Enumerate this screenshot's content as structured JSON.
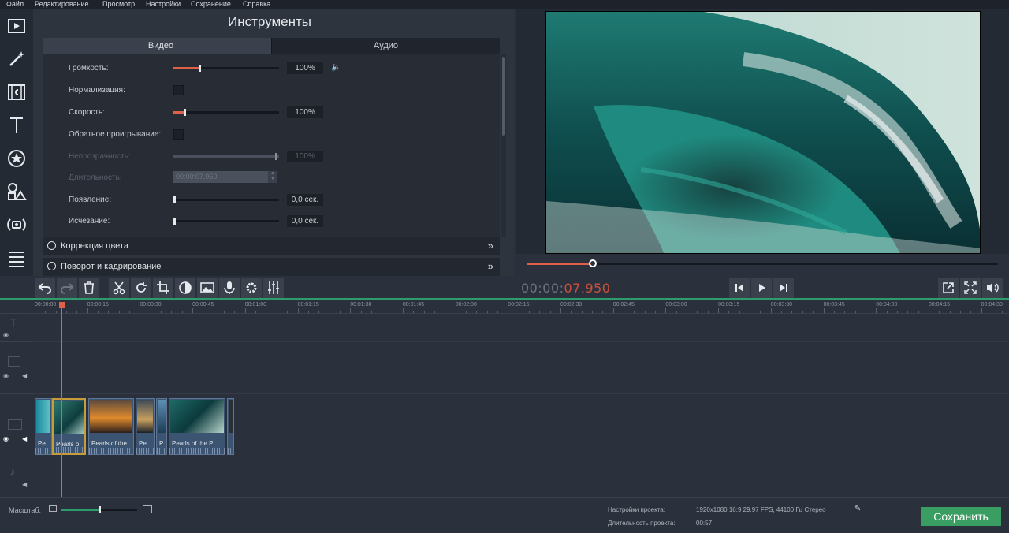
{
  "menu": [
    "Файл",
    "Редактирование",
    "Просмотр",
    "Настройки",
    "Сохранение",
    "Справка"
  ],
  "tools_panel": {
    "title": "Инструменты",
    "tabs": [
      "Видео",
      "Аудио"
    ],
    "properties": {
      "volume_label": "Громкость:",
      "volume_value": "100%",
      "volume_level": 0.25,
      "normalization_label": "Нормализация:",
      "speed_label": "Скорость:",
      "speed_value": "100%",
      "speed_level": 0.1,
      "reverse_label": "Обратное проигрывание:",
      "opacity_label": "Непрозрачность:",
      "opacity_value": "100%",
      "duration_label": "Длительность:",
      "duration_value": "00:00:07.950",
      "fadein_label": "Появление:",
      "fadein_value": "0,0 сек.",
      "fadeout_label": "Исчезание:",
      "fadeout_value": "0,0 сек."
    },
    "sections": [
      "Коррекция цвета",
      "Поворот и кадрирование"
    ]
  },
  "player": {
    "timecode_elapsed": "00:00:",
    "timecode_current": "07.950",
    "progress": 0.14
  },
  "timeline": {
    "ticks": [
      "00:00:00",
      "00:00:15",
      "00:00:30",
      "00:00:45",
      "00:01:00",
      "00:01:15",
      "00:01:30",
      "00:01:45",
      "00:02:00",
      "00:02:15",
      "00:02:30",
      "00:02:45",
      "00:03:00",
      "00:03:15",
      "00:03:30",
      "00:03:45",
      "00:04:00",
      "00:04:15",
      "00:04:30"
    ],
    "clips": [
      {
        "title": "Pe"
      },
      {
        "title": "Pearls o"
      },
      {
        "title": "Pearls of the"
      },
      {
        "title": "Pe"
      },
      {
        "title": "P"
      },
      {
        "title": "Pearls of the P"
      },
      {
        "title": ""
      }
    ]
  },
  "status": {
    "scale_label": "Масштаб:",
    "scale_level": 0.5,
    "project_settings_label": "Настройки проекта:",
    "project_settings_value": "1920x1080 16:9 29.97 FPS, 44100 Гц Стерео",
    "project_duration_label": "Длительность проекта:",
    "project_duration_value": "00:57",
    "save_label": "Сохранить"
  },
  "colors": {
    "accent": "#e0604a",
    "save": "#3a9e63",
    "timeline_line": "#2e9c6a"
  },
  "icons": [
    "import-icon",
    "magic-wand-icon",
    "filters-icon",
    "titles-icon",
    "stickers-icon",
    "transitions-icon",
    "record-icon",
    "menu-icon",
    "undo-icon",
    "redo-icon",
    "trash-icon",
    "cut-icon",
    "rotate-icon",
    "crop-icon",
    "color-icon",
    "image-icon",
    "mic-icon",
    "gear-icon",
    "equalizer-icon",
    "prev-icon",
    "play-icon",
    "next-icon",
    "popout-icon",
    "fullscreen-icon",
    "volume-icon"
  ]
}
